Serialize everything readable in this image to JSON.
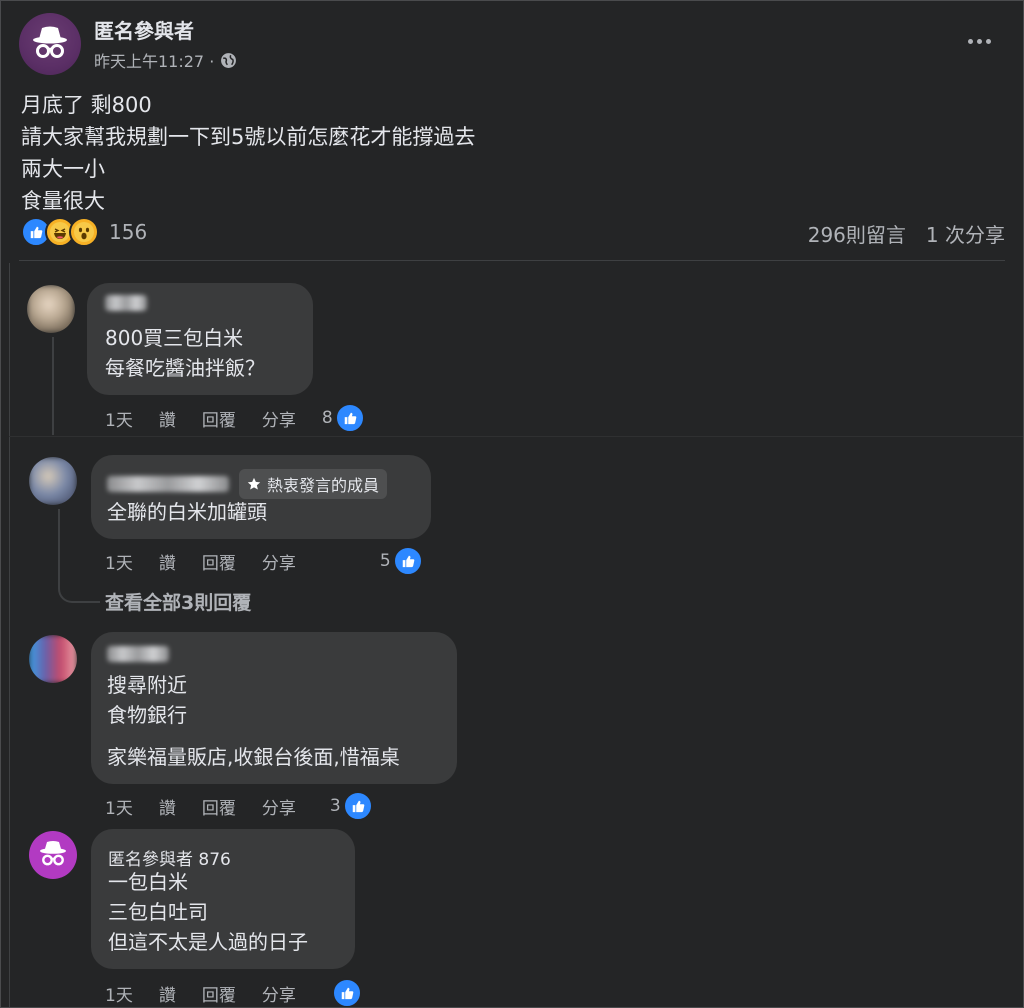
{
  "post": {
    "author": "匿名參與者",
    "time": "昨天上午11:27 ·",
    "lines": [
      "月底了 剩800",
      "請大家幫我規劃一下到5號以前怎麼花才能撐過去",
      "兩大一小",
      "食量很大"
    ],
    "reaction_count": "156",
    "comment_count": "296則留言",
    "share_count": "1 次分享",
    "reactions": [
      "like-icon",
      "haha-icon",
      "wow-icon"
    ]
  },
  "actions": {
    "like": "讚",
    "reply": "回覆",
    "share": "分享"
  },
  "comments": [
    {
      "time": "1天",
      "lines": [
        "800買三包白米",
        "每餐吃醬油拌飯？"
      ],
      "likes": "8"
    },
    {
      "time": "1天",
      "badge": "熱衷發言的成員",
      "lines": [
        "全聯的白米加罐頭"
      ],
      "likes": "5",
      "view_replies": "查看全部3則回覆"
    },
    {
      "time": "1天",
      "lines": [
        "搜尋附近",
        "食物銀行",
        "家樂福量販店,收銀台後面,惜福桌"
      ],
      "likes": "3"
    },
    {
      "author": "匿名參與者 876",
      "time": "1天",
      "lines": [
        "一包白米",
        "三包白吐司",
        "但這不太是人過的日子"
      ],
      "likes": ""
    }
  ],
  "colors": {
    "background": "#242526",
    "bubble": "#3a3b3c",
    "like_blue": "#2d88ff",
    "anon_purple": "#6a3d72"
  }
}
